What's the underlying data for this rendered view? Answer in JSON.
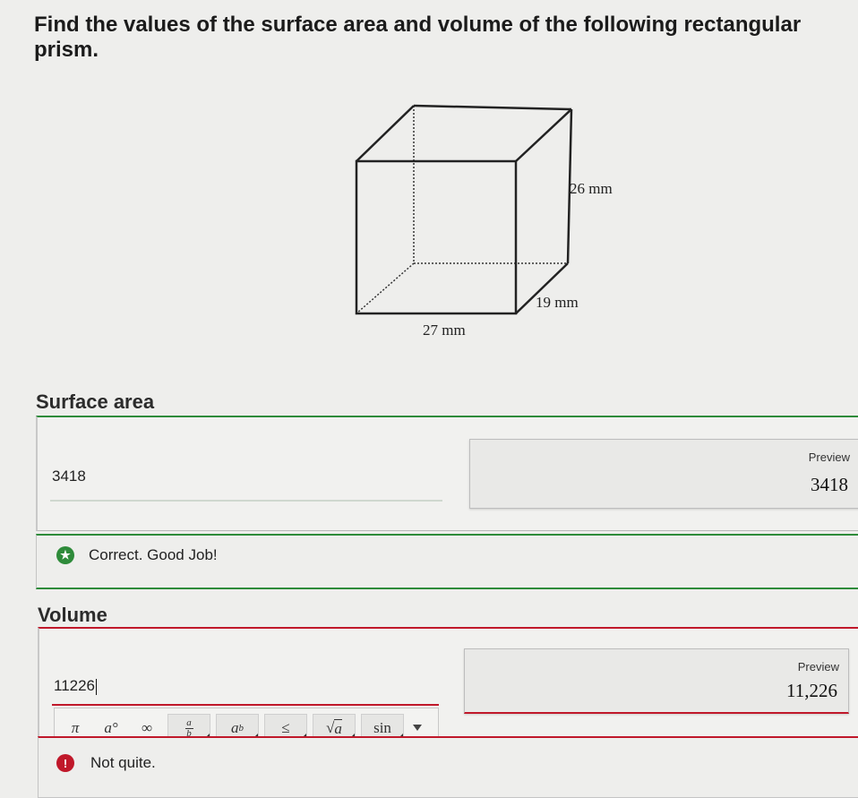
{
  "question": {
    "title": "Find the values of the surface area and volume of the following rectangular prism."
  },
  "figure": {
    "height_label": "26 mm",
    "depth_label": "19 mm",
    "width_label": "27 mm"
  },
  "surface_area": {
    "label": "Surface area",
    "input_value": "3418",
    "preview_label": "Preview",
    "preview_value": "3418",
    "feedback_text": "Correct. Good Job!",
    "feedback_color": "#2e8b3a"
  },
  "volume": {
    "label": "Volume",
    "input_value": "11226",
    "preview_label": "Preview",
    "preview_value": "11,226",
    "feedback_text": "Not quite.",
    "feedback_color": "#c0182a"
  },
  "toolbar": {
    "pi": "π",
    "degree": "a°",
    "infinity": "∞",
    "fraction_top": "a",
    "fraction_bottom": "b",
    "power_base": "a",
    "power_exp": "b",
    "leq": "≤",
    "sqrt": "a",
    "sin": "sin"
  }
}
